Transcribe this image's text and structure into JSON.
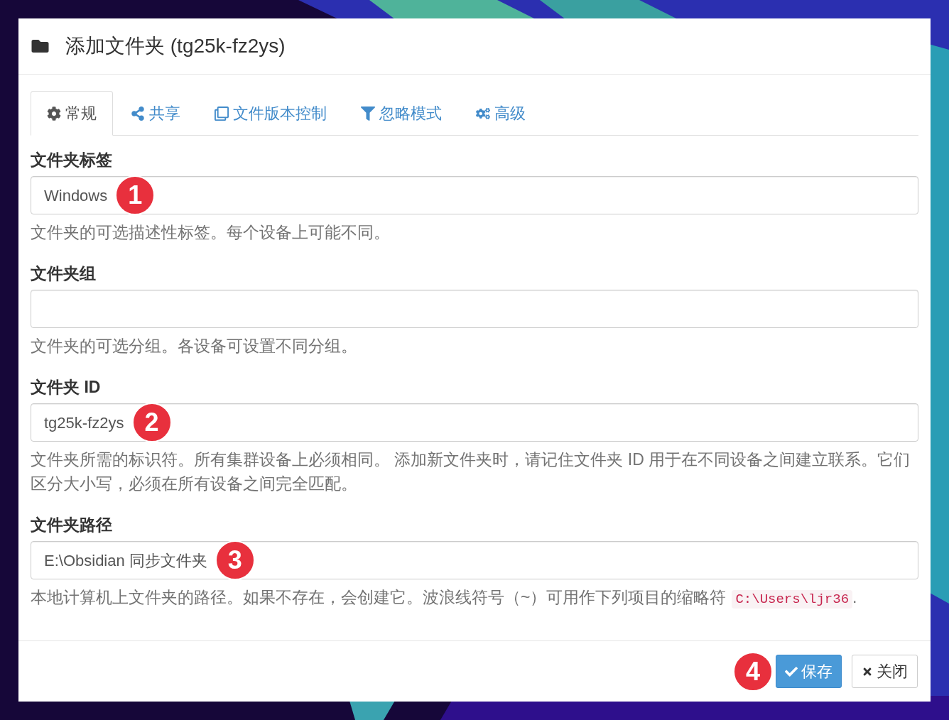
{
  "dialog": {
    "title": "添加文件夹 (tg25k-fz2ys)"
  },
  "tabs": [
    {
      "label": "常规",
      "selected": true
    },
    {
      "label": "共享",
      "selected": false
    },
    {
      "label": "文件版本控制",
      "selected": false
    },
    {
      "label": "忽略模式",
      "selected": false
    },
    {
      "label": "高级",
      "selected": false
    }
  ],
  "fields": [
    {
      "label": "文件夹标签",
      "value": "Windows",
      "marker": "1",
      "help": "文件夹的可选描述性标签。每个设备上可能不同。"
    },
    {
      "label": "文件夹组",
      "help": "文件夹的可选分组。各设备可设置不同分组。"
    },
    {
      "label": "文件夹 ID",
      "value": "tg25k-fz2ys",
      "marker": "2",
      "help": "文件夹所需的标识符。所有集群设备上必须相同。 添加新文件夹时，请记住文件夹 ID 用于在不同设备之间建立联系。它们区分大小写，必须在所有设备之间完全匹配。"
    },
    {
      "label": "文件夹路径",
      "value": "E:\\Obsidian 同步文件夹",
      "marker": "3",
      "help": "本地计算机上文件夹的路径。如果不存在，会创建它。波浪线符号（~）可用作下列项目的缩略符",
      "help_code": "C:\\Users\\ljr36",
      "help_suffix": "."
    }
  ],
  "footer": {
    "marker": "4",
    "buttons": [
      {
        "label": "保存",
        "kind": "primary"
      },
      {
        "label": "关闭",
        "kind": "default"
      }
    ]
  }
}
